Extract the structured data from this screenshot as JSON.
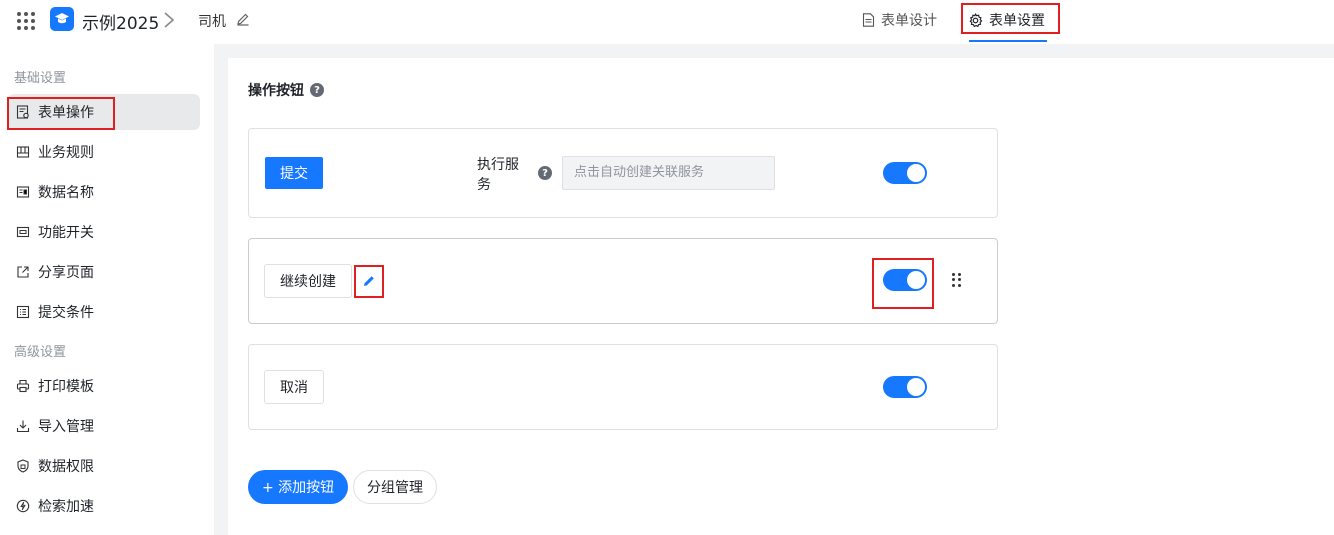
{
  "header": {
    "app_title": "示例2025",
    "form_name": "司机",
    "tabs": [
      {
        "label": "表单设计"
      },
      {
        "label": "表单设置"
      }
    ]
  },
  "sidebar": {
    "groups": [
      {
        "label": "基础设置"
      },
      {
        "label": "高级设置"
      }
    ],
    "items": [
      {
        "label": "表单操作",
        "icon": "form-doc-icon"
      },
      {
        "label": "业务规则",
        "icon": "rules-icon"
      },
      {
        "label": "数据名称",
        "icon": "data-name-icon"
      },
      {
        "label": "功能开关",
        "icon": "switch-icon"
      },
      {
        "label": "分享页面",
        "icon": "share-icon"
      },
      {
        "label": "提交条件",
        "icon": "checklist-icon"
      },
      {
        "label": "打印模板",
        "icon": "printer-icon"
      },
      {
        "label": "导入管理",
        "icon": "download-icon"
      },
      {
        "label": "数据权限",
        "icon": "shield-icon"
      },
      {
        "label": "检索加速",
        "icon": "lightning-icon"
      }
    ]
  },
  "main": {
    "section_title": "操作按钮",
    "buttons": [
      {
        "label": "提交",
        "service_label": "执行服务",
        "service_placeholder": "点击自动创建关联服务",
        "enabled": true
      },
      {
        "label": "继续创建",
        "enabled": true
      },
      {
        "label": "取消",
        "enabled": true
      }
    ],
    "add_button": "+ 添加按钮",
    "group_button": "分组管理"
  },
  "colors": {
    "accent": "#1677ff",
    "highlight_box": "#e02020"
  }
}
